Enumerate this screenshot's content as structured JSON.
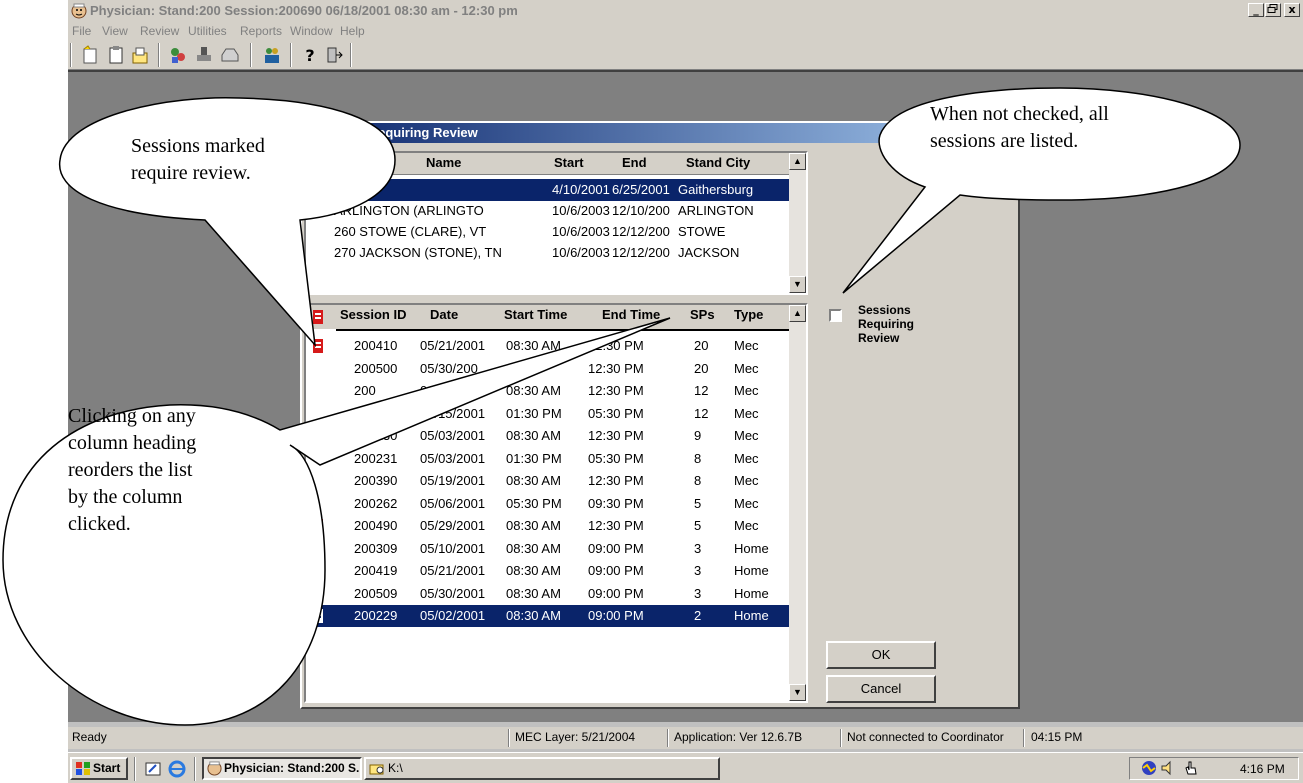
{
  "window": {
    "title": "Physician: Stand:200 Session:200690 06/18/2001 08:30 am - 12:30 pm",
    "controls": [
      "_",
      "□",
      "x"
    ]
  },
  "menu": [
    "File",
    "View",
    "Review",
    "Utilities",
    "Reports",
    "Window",
    "Help"
  ],
  "toolbar_icons": [
    "new-icon",
    "clipboard-icon",
    "open-icon",
    "group-icon",
    "stamp-icon",
    "inbox-icon",
    "people-icon",
    "help-icon",
    "exit-icon"
  ],
  "dialog": {
    "title": "Sessions Requiring Review",
    "stands": {
      "headers": {
        "name": "Name",
        "start": "Start",
        "end": "End",
        "stand_city": "Stand City"
      },
      "rows": [
        {
          "name": "g",
          "start": "4/10/2001",
          "end": "6/25/2001",
          "city": "Gaithersburg",
          "selected": true
        },
        {
          "name": "ARLINGTON (ARLINGTO",
          "start": "10/6/2003",
          "end": "12/10/200",
          "city": "ARLINGTON",
          "selected": false
        },
        {
          "name": "260 STOWE (CLARE), VT",
          "start": "10/6/2003",
          "end": "12/12/200",
          "city": "STOWE",
          "selected": false
        },
        {
          "name": "270 JACKSON (STONE), TN",
          "start": "10/6/2003",
          "end": "12/12/200",
          "city": "JACKSON",
          "selected": false
        }
      ]
    },
    "sessions": {
      "headers": {
        "session_id": "Session ID",
        "date": "Date",
        "start_time": "Start Time",
        "end_time": "End Time",
        "sps": "SPs",
        "type": "Type"
      },
      "rows": [
        {
          "id": "200410",
          "date": "05/21/2001",
          "start": "08:30 AM",
          "end": "12:30 PM",
          "sps": "20",
          "type": "Mec",
          "flag": true,
          "selected": false
        },
        {
          "id": "200500",
          "date": "05/30/200",
          "start": "AM",
          "end": "12:30 PM",
          "sps": "20",
          "type": "Mec",
          "flag": false,
          "selected": false
        },
        {
          "id": "200",
          "date": "01",
          "start": "08:30 AM",
          "end": "12:30 PM",
          "sps": "12",
          "type": "Mec",
          "flag": false,
          "selected": false
        },
        {
          "id": "",
          "date": "05/15/2001",
          "start": "01:30 PM",
          "end": "05:30 PM",
          "sps": "12",
          "type": "Mec",
          "flag": false,
          "selected": false
        },
        {
          "id": "200230",
          "date": "05/03/2001",
          "start": "08:30 AM",
          "end": "12:30 PM",
          "sps": "9",
          "type": "Mec",
          "flag": false,
          "selected": false
        },
        {
          "id": "200231",
          "date": "05/03/2001",
          "start": "01:30 PM",
          "end": "05:30 PM",
          "sps": "8",
          "type": "Mec",
          "flag": false,
          "selected": false
        },
        {
          "id": "200390",
          "date": "05/19/2001",
          "start": "08:30 AM",
          "end": "12:30 PM",
          "sps": "8",
          "type": "Mec",
          "flag": false,
          "selected": false
        },
        {
          "id": "200262",
          "date": "05/06/2001",
          "start": "05:30 PM",
          "end": "09:30 PM",
          "sps": "5",
          "type": "Mec",
          "flag": false,
          "selected": false
        },
        {
          "id": "200490",
          "date": "05/29/2001",
          "start": "08:30 AM",
          "end": "12:30 PM",
          "sps": "5",
          "type": "Mec",
          "flag": true,
          "selected": false
        },
        {
          "id": "200309",
          "date": "05/10/2001",
          "start": "08:30 AM",
          "end": "09:00 PM",
          "sps": "3",
          "type": "Home",
          "flag": false,
          "selected": false
        },
        {
          "id": "200419",
          "date": "05/21/2001",
          "start": "08:30 AM",
          "end": "09:00 PM",
          "sps": "3",
          "type": "Home",
          "flag": false,
          "selected": false
        },
        {
          "id": "200509",
          "date": "05/30/2001",
          "start": "08:30 AM",
          "end": "09:00 PM",
          "sps": "3",
          "type": "Home",
          "flag": false,
          "selected": false
        },
        {
          "id": "200229",
          "date": "05/02/2001",
          "start": "08:30 AM",
          "end": "09:00 PM",
          "sps": "2",
          "type": "Home",
          "flag": true,
          "selected": true
        }
      ]
    },
    "checkbox_label_lines": [
      "Sessions",
      "Requiring",
      "Review"
    ],
    "checkbox_checked": false,
    "ok_label": "OK",
    "cancel_label": "Cancel"
  },
  "status": {
    "left": "Ready",
    "mec_layer": "MEC Layer: 5/21/2004",
    "application": "Application: Ver 12.6.7B",
    "coordinator": "Not connected to Coordinator",
    "time": "04:15 PM"
  },
  "taskbar": {
    "start": "Start",
    "tasks": [
      "Physician: Stand:200 S...",
      "K:\\"
    ],
    "clock": "4:16 PM"
  },
  "callouts": {
    "review_marked_lines": [
      "Sessions marked",
      "require review."
    ],
    "not_checked_lines": [
      "When not checked, all",
      "sessions are listed."
    ],
    "column_heading_lines": [
      "Clicking on any",
      "column heading",
      "reorders the list",
      "by the column",
      "clicked."
    ]
  },
  "colors": {
    "selection": "#0a246a",
    "flag": "#d61a1a",
    "desktop": "#808080",
    "chrome": "#d4d0c8"
  }
}
